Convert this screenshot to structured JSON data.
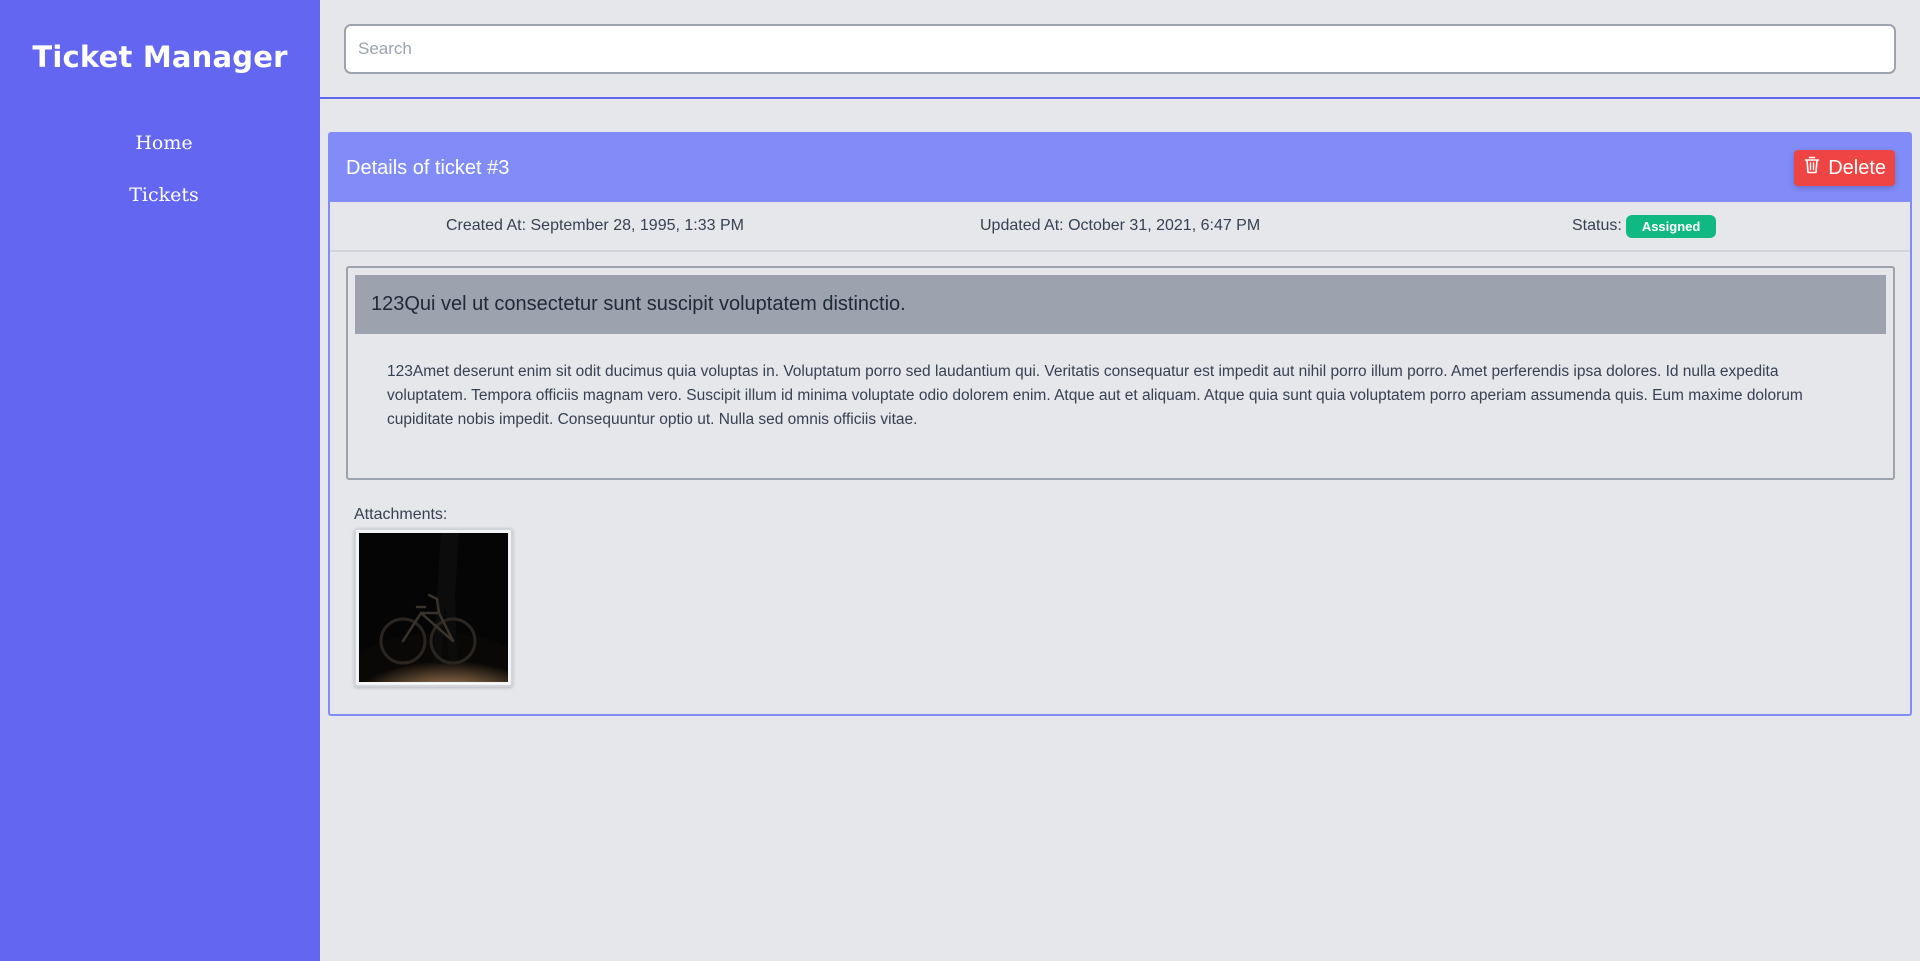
{
  "sidebar": {
    "brand": "Ticket Manager",
    "nav": [
      {
        "label": "Home"
      },
      {
        "label": "Tickets"
      }
    ]
  },
  "search": {
    "placeholder": "Search",
    "value": ""
  },
  "ticket": {
    "header_title": "Details of ticket #3",
    "delete_label": "Delete",
    "created_at": "Created At: September 28, 1995, 1:33 PM",
    "updated_at": "Updated At: October 31, 2021, 6:47 PM",
    "status_label": "Status:",
    "status_value": "Assigned",
    "subject": "123Qui vel ut consectetur sunt suscipit voluptatem distinctio.",
    "body": "123Amet deserunt enim sit odit ducimus quia voluptas in. Voluptatum porro sed laudantium qui. Veritatis consequatur est impedit aut nihil porro illum porro. Amet perferendis ipsa dolores. Id nulla expedita voluptatem. Tempora officiis magnam vero. Suscipit illum id minima voluptate odio dolorem enim. Atque aut et aliquam. Atque quia sunt quia voluptatem porro aperiam assumenda quis. Eum maxime dolorum cupiditate nobis impedit. Consequuntur optio ut. Nulla sed omnis officiis vitae.",
    "attachments_label": "Attachments:"
  },
  "colors": {
    "sidebar": "#6366f1",
    "header": "#818cf8",
    "delete": "#ef4444",
    "status_badge": "#10b981",
    "subject_bg": "#9ca3af",
    "page_bg": "#e5e7eb"
  },
  "icons": {
    "delete": "trash-icon",
    "attachment": "bicycle-photo"
  }
}
